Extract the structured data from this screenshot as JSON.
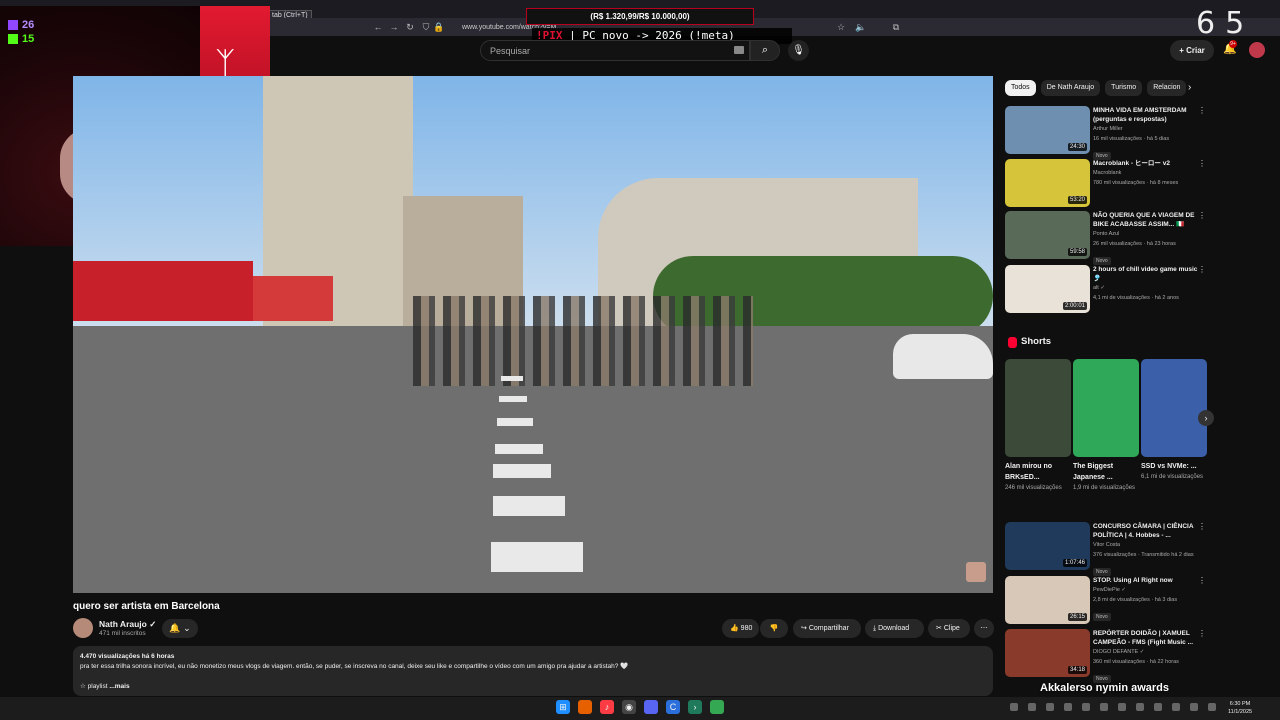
{
  "browser": {
    "tooltip": "tab (Ctrl+T)",
    "url": "www.youtube.com/watch?v=M..."
  },
  "overlay": {
    "goal_text": "(R$ 1.320,99/R$ 10.000,00)",
    "goal_progress": 0.132,
    "ticker_cmd": "!PIX",
    "ticker_text": " | PC novo -> 2026 (!meta)",
    "counter_left": "6",
    "counter_right": "5",
    "twitch_count": "26",
    "kick_count": "15",
    "bottom_text": "Akkalerso nymin awards"
  },
  "header": {
    "search_placeholder": "Pesquisar",
    "create_label": "Criar",
    "notif_count": "9+"
  },
  "video": {
    "title": "quero ser artista em Barcelona",
    "channel": "Nath Araujo",
    "subscribers": "471 mil inscritos",
    "likes": "980",
    "share_label": "Compartilhar",
    "download_label": "Download",
    "clip_label": "Clipe",
    "views_line": "4.470 visualizações  há 6 horas",
    "description": "pra ter essa trilha sonora incrível, eu não monetizo meus vlogs de viagem. então, se puder, se inscreva no canal, deixe seu like e compartilhe o vídeo com um amigo pra ajudar a artistah? 🤍",
    "playlist_line": "☆ playlist",
    "more_label": "...mais"
  },
  "chips": [
    "Todos",
    "De Nath Araujo",
    "Turismo",
    "Relacion"
  ],
  "recs_top": [
    {
      "title": "MINHA VIDA EM AMSTERDAM (perguntas e respostas)",
      "channel": "Arthur Miller",
      "meta": "16 mil visualizações · há 5 dias",
      "badge": "Novo",
      "duration": "24:30",
      "color": "#6e8fb0"
    },
    {
      "title": "Macroblank - ヒーロー v2",
      "channel": "Macroblank",
      "meta": "780 mil visualizações · há 8 meses",
      "badge": "",
      "duration": "53:20",
      "color": "#d6c43a"
    },
    {
      "title": "NÃO QUERIA QUE A VIAGEM DE BIKE ACABASSE ASSIM... 🇮🇹",
      "channel": "Ponto Azul",
      "meta": "26 mil visualizações · há 23 horas",
      "badge": "Novo",
      "duration": "59:58",
      "color": "#5a6a58"
    },
    {
      "title": "2 hours of chill video game music 🎐",
      "channel": "alt ✓",
      "meta": "4,1 mi de visualizações · há 2 anos",
      "badge": "",
      "duration": "2:00:01",
      "color": "#e8e2d8"
    }
  ],
  "shorts_label": "Shorts",
  "shorts": [
    {
      "title": "Alan mirou no BRKsED...",
      "views": "246 mil visualizações",
      "color": "#3c4a3a"
    },
    {
      "title": "The Biggest Japanese ...",
      "views": "1,9 mi de visualizações",
      "color": "#2fa85a"
    },
    {
      "title": "SSD vs NVMe: ...",
      "views": "6,1 mi de visualizações",
      "color": "#3b5fa8"
    }
  ],
  "recs_bottom": [
    {
      "title": "CONCURSO CÂMARA | CIÊNCIA POLÍTICA | 4. Hobbes - ...",
      "channel": "Vitor Costa",
      "meta": "376 visualizações · Transmitido há 2 dias",
      "badge": "Novo",
      "duration": "1:07:46",
      "color": "#1f3a5a"
    },
    {
      "title": "STOP. Using AI Right now",
      "channel": "PewDiePie ✓",
      "meta": "2,8 mi de visualizações · há 3 dias",
      "badge": "Novo",
      "duration": "26:15",
      "color": "#d8c8b8"
    },
    {
      "title": "REPÓRTER DOIDÃO | XAMUEL CAMPEÃO - FMS (Fight Music ...",
      "channel": "DIOGO DEFANTE ✓",
      "meta": "360 mil visualizações · há 22 horas",
      "badge": "Novo",
      "duration": "34:18",
      "color": "#8a3a2a"
    }
  ],
  "clock": {
    "time": "6:30 PM",
    "date": "11/1/2025"
  }
}
